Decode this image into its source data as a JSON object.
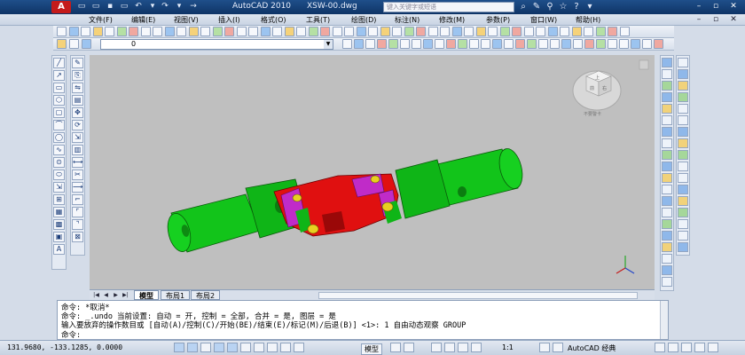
{
  "window": {
    "app_logo": "A",
    "title": "AutoCAD 2010",
    "file": "XSW-00.dwg",
    "search_placeholder": "键入关键字或短语",
    "min": "–",
    "max": "▫",
    "close": "✕"
  },
  "menu": [
    "文件(F)",
    "编辑(E)",
    "视图(V)",
    "插入(I)",
    "格式(O)",
    "工具(T)",
    "绘图(D)",
    "标注(N)",
    "修改(M)",
    "参数(P)",
    "窗口(W)",
    "帮助(H)"
  ],
  "layer_combo": "0",
  "viewcube": {
    "top": "上",
    "front": "前",
    "right": "右",
    "compass": "不要警卡"
  },
  "model_tabs": [
    "模型",
    "布局1",
    "布局2"
  ],
  "command_lines": [
    "命令: *取消*",
    "命令: _.undo 当前设置: 自动 = 开, 控制 = 全部, 合并 = 是, 图层 = 是",
    "输入要放弃的操作数目或 [自动(A)/控制(C)/开始(BE)/结束(E)/标记(M)/后退(B)] <1>: 1 自由动态观察 GROUP",
    "命令:"
  ],
  "status": {
    "coords": "131.9680, -133.1285, 0.0000",
    "model_label": "模型",
    "scale_label": "1:1",
    "workspace": "AutoCAD 经典"
  },
  "colors": {
    "body": "#12c41a",
    "yoke": "#e01010",
    "pin": "#c02bc8",
    "bolt": "#e8d020",
    "viewport": "#bfbfbf"
  }
}
